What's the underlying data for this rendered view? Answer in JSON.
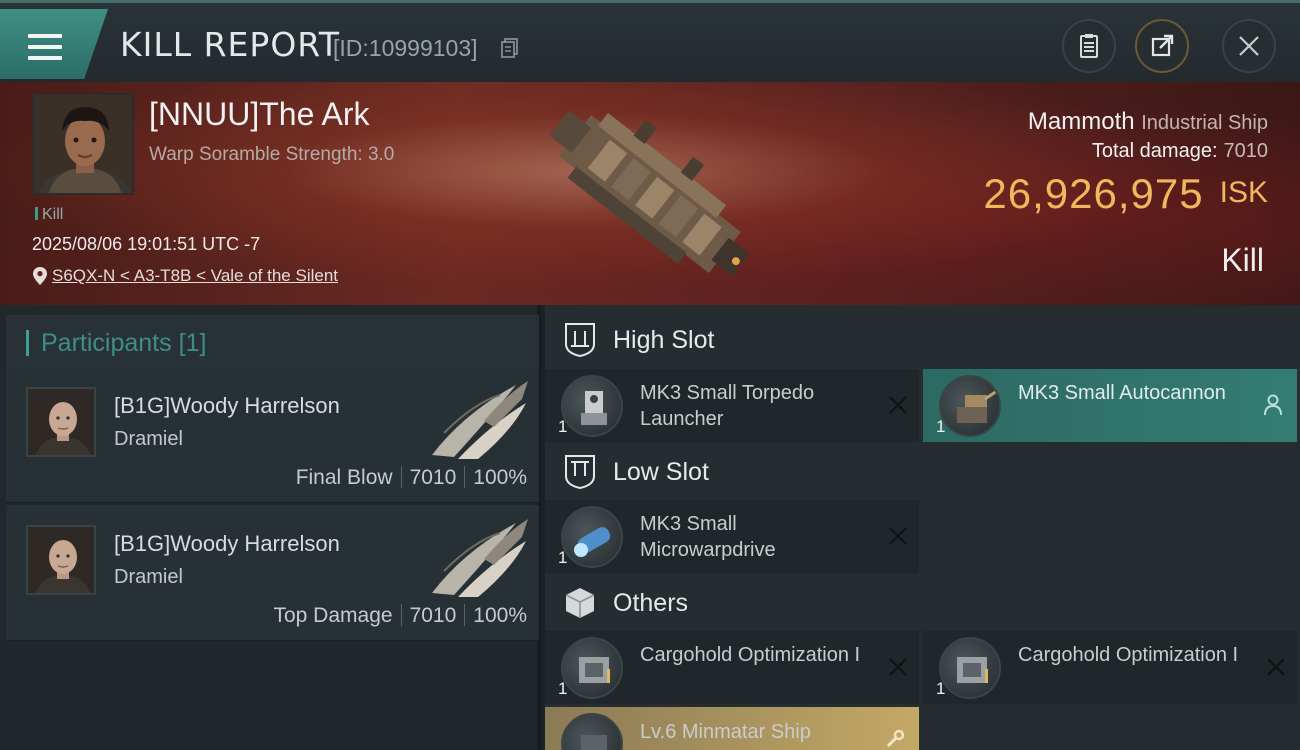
{
  "header": {
    "title": "KILL REPORT",
    "report_id": "[ID:10999103]",
    "icons": [
      "menu-icon",
      "copy-icon",
      "clipboard-icon",
      "share-icon",
      "close-icon"
    ]
  },
  "victim": {
    "name": "[NNUU]The Ark",
    "warp_scramble": "Warp Soramble Strength: 3.0",
    "tag": "Kill",
    "datetime": "2025/08/06 19:01:51 UTC -7",
    "location": "S6QX-N < A3-T8B < Vale of the Silent",
    "ship_name": "Mammoth",
    "ship_class": "Industrial Ship",
    "total_damage_label": "Total damage:",
    "total_damage": "7010",
    "isk_value": "26,926,975",
    "isk_unit": "ISK",
    "result": "Kill"
  },
  "participants": {
    "label": "Participants",
    "count": "[1]",
    "rows": [
      {
        "name": "[B1G]Woody Harrelson",
        "ship": "Dramiel",
        "role": "Final Blow",
        "damage": "7010",
        "percent": "100%"
      },
      {
        "name": "[B1G]Woody Harrelson",
        "ship": "Dramiel",
        "role": "Top Damage",
        "damage": "7010",
        "percent": "100%"
      }
    ]
  },
  "fitting": {
    "high": {
      "label": "High Slot",
      "items": [
        {
          "name": "MK3 Small Torpedo Launcher",
          "qty": "1",
          "status": "destroyed"
        },
        {
          "name": "MK3 Small Autocannon",
          "qty": "1",
          "status": "dropped"
        }
      ]
    },
    "low": {
      "label": "Low Slot",
      "items": [
        {
          "name": "MK3 Small Microwarpdrive",
          "qty": "1",
          "status": "destroyed"
        }
      ]
    },
    "others": {
      "label": "Others",
      "items": [
        {
          "name": "Cargohold Optimization I",
          "qty": "1",
          "status": "destroyed"
        },
        {
          "name": "Cargohold Optimization I",
          "qty": "1",
          "status": "destroyed"
        },
        {
          "name": "Lv.6 Minmatar Ship",
          "qty": "",
          "status": "rig"
        }
      ]
    }
  },
  "colors": {
    "accent_teal": "#3f8f85",
    "isk_gold": "#f0b75c",
    "banner_red": "#6a2a22"
  }
}
